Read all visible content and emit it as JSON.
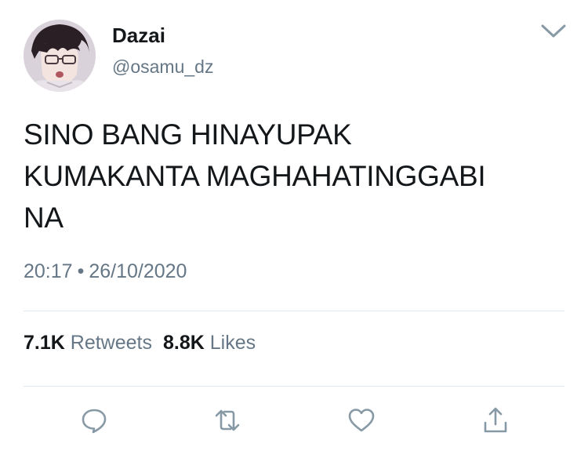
{
  "author": {
    "display_name": "Dazai",
    "handle": "@osamu_dz",
    "avatar_icon": "anime-avatar"
  },
  "tweet": {
    "text": "SINO BANG HINAYUPAK\nKUMAKANTA MAGHAHATINGGABI\nNA",
    "time": "20:17",
    "separator": "•",
    "date": "26/10/2020"
  },
  "stats": {
    "retweets_count": "7.1K",
    "retweets_label": "Retweets",
    "likes_count": "8.8K",
    "likes_label": "Likes"
  },
  "actions": {
    "reply_icon": "reply-icon",
    "retweet_icon": "retweet-icon",
    "like_icon": "heart-icon",
    "share_icon": "share-icon"
  },
  "colors": {
    "text": "#14171a",
    "secondary": "#657786",
    "icon": "#8899a6",
    "divider": "#e1e8ed"
  }
}
